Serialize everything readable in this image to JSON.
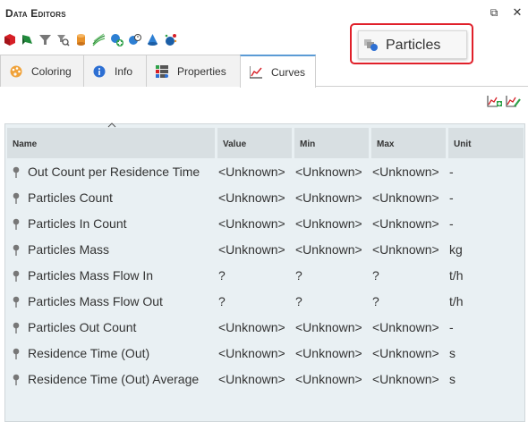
{
  "window": {
    "title": "Data Editors",
    "restore_symbol": "⧉",
    "close_symbol": "✕"
  },
  "toolbar": {
    "icons": [
      "red-cube-icon",
      "green-flag-icon",
      "funnel-icon",
      "search-filter-icon",
      "orange-cylinder-icon",
      "green-lines-icon",
      "add-particle-icon",
      "particle-timer-icon",
      "blue-cone-icon",
      "particle-emitter-icon"
    ]
  },
  "tooltip": {
    "label": "Particles"
  },
  "tabs": [
    {
      "label": "Coloring",
      "icon": "palette-icon"
    },
    {
      "label": "Info",
      "icon": "info-icon"
    },
    {
      "label": "Properties",
      "icon": "properties-icon"
    },
    {
      "label": "Curves",
      "icon": "curves-icon",
      "active": true
    }
  ],
  "table": {
    "headers": {
      "name": "Name",
      "value": "Value",
      "min": "Min",
      "max": "Max",
      "unit": "Unit"
    },
    "rows": [
      {
        "name": "Out Count per Residence Time",
        "value": "<Unknown>",
        "min": "<Unknown>",
        "max": "<Unknown>",
        "unit": "-"
      },
      {
        "name": "Particles Count",
        "value": "<Unknown>",
        "min": "<Unknown>",
        "max": "<Unknown>",
        "unit": "-"
      },
      {
        "name": "Particles In Count",
        "value": "<Unknown>",
        "min": "<Unknown>",
        "max": "<Unknown>",
        "unit": "-"
      },
      {
        "name": "Particles Mass",
        "value": "<Unknown>",
        "min": "<Unknown>",
        "max": "<Unknown>",
        "unit": "kg"
      },
      {
        "name": "Particles Mass Flow In",
        "value": "?",
        "min": "?",
        "max": "?",
        "unit": "t/h"
      },
      {
        "name": "Particles Mass Flow Out",
        "value": "?",
        "min": "?",
        "max": "?",
        "unit": "t/h"
      },
      {
        "name": "Particles Out Count",
        "value": "<Unknown>",
        "min": "<Unknown>",
        "max": "<Unknown>",
        "unit": "-"
      },
      {
        "name": "Residence Time (Out)",
        "value": "<Unknown>",
        "min": "<Unknown>",
        "max": "<Unknown>",
        "unit": "s"
      },
      {
        "name": "Residence Time (Out) Average",
        "value": "<Unknown>",
        "min": "<Unknown>",
        "max": "<Unknown>",
        "unit": "s"
      }
    ]
  },
  "colors": {
    "accent": "#5b9bd5",
    "highlight": "#e0202a",
    "grid_bg": "#e9f0f3",
    "header_bg": "#d8dfe2"
  }
}
